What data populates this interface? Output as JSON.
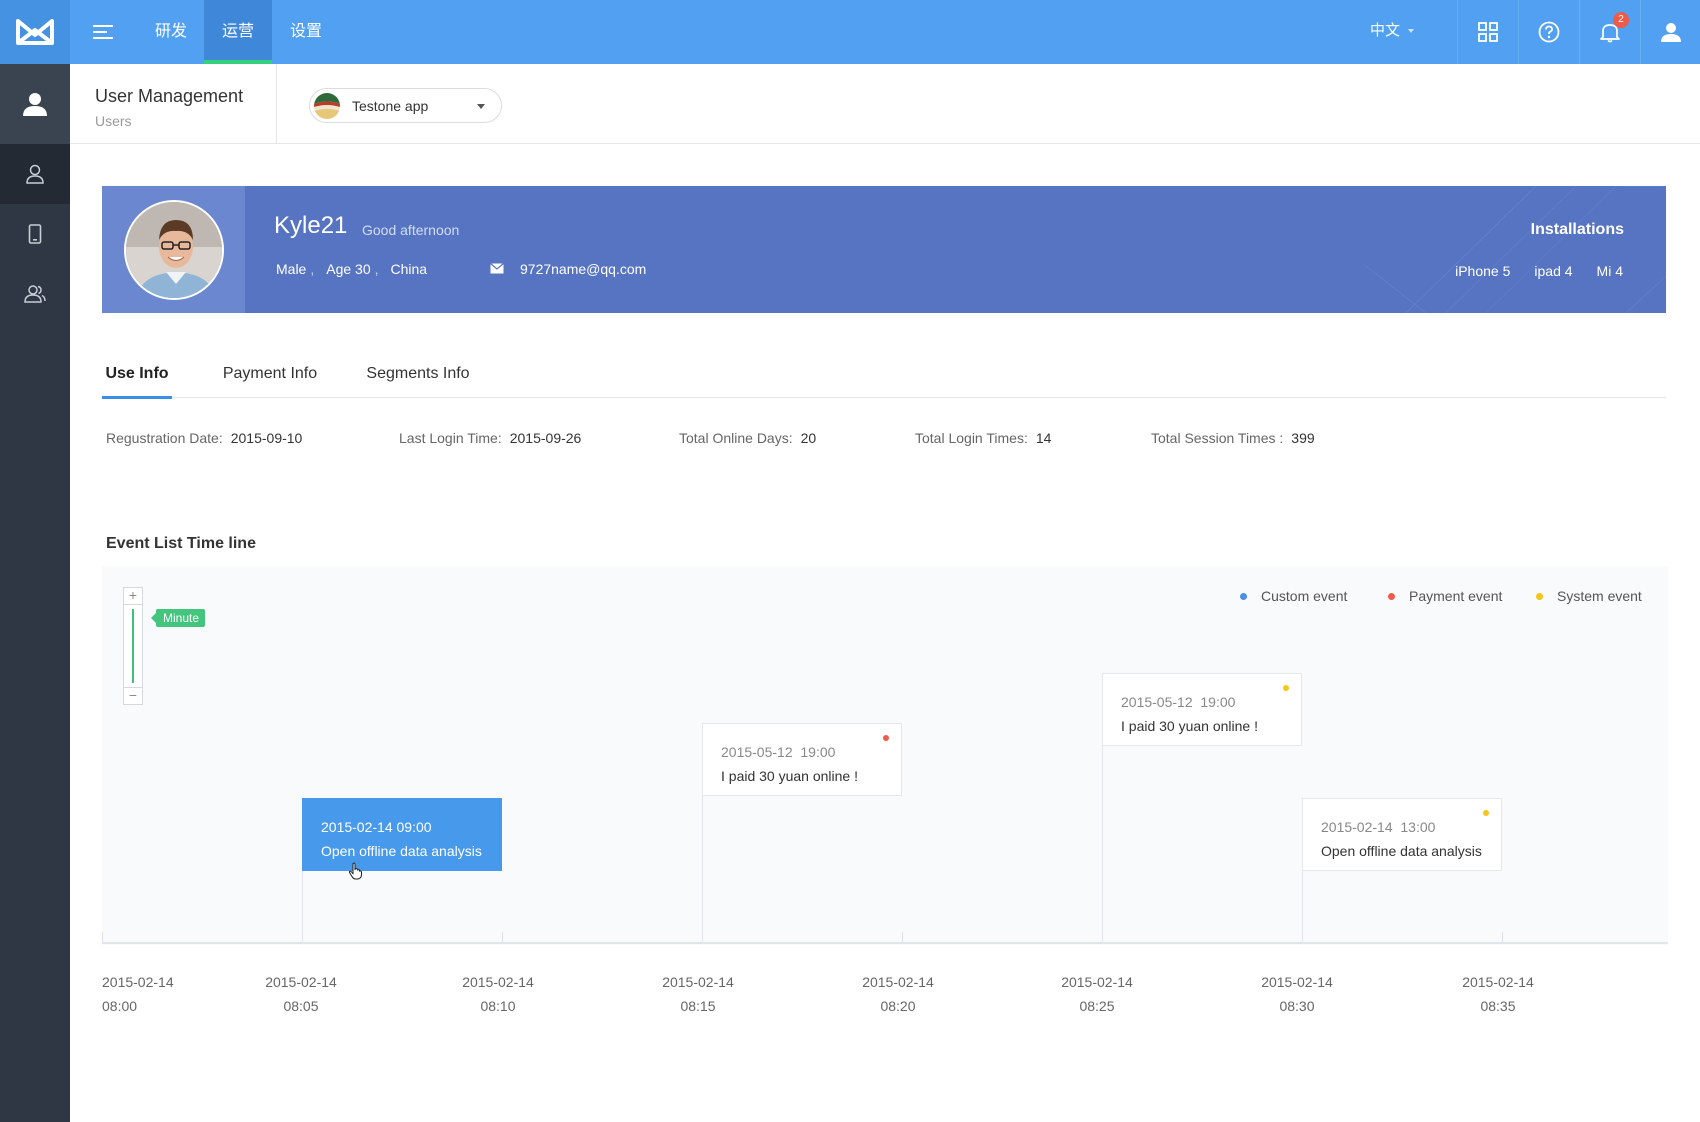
{
  "topbar": {
    "nav": [
      "研发",
      "运营",
      "设置"
    ],
    "active_nav": "运营",
    "language": "中文",
    "notification_count": "2"
  },
  "sidebar": {
    "items": [
      "user-profile",
      "users",
      "devices",
      "groups"
    ]
  },
  "subheader": {
    "title": "User Management",
    "breadcrumb": "Users",
    "app_name": "Testone app"
  },
  "profile": {
    "name": "Kyle21",
    "greeting": "Good afternoon",
    "gender": "Male",
    "age": "Age 30",
    "country": "China",
    "email": "9727name@qq.com",
    "installations_title": "Installations",
    "installations": [
      "iPhone 5",
      "ipad 4",
      "Mi 4"
    ]
  },
  "tabs": [
    "Use Info",
    "Payment Info",
    "Segments Info"
  ],
  "stats": [
    {
      "label": "Regustration Date:",
      "value": "2015-09-10"
    },
    {
      "label": "Last Login Time:",
      "value": "2015-09-26"
    },
    {
      "label": "Total Online Days:",
      "value": "20"
    },
    {
      "label": "Total Login Times:",
      "value": "14"
    },
    {
      "label": "Total Session Times :",
      "value": "399"
    }
  ],
  "timeline": {
    "title": "Event List Time line",
    "zoom_level": "Minute",
    "legend": [
      {
        "label": "Custom event",
        "color": "#4a90e2"
      },
      {
        "label": "Payment event",
        "color": "#ef5a4a"
      },
      {
        "label": "System event",
        "color": "#f5c518"
      }
    ],
    "events": [
      {
        "time": "2015-02-14 09:00",
        "text": "Open offline data analysis",
        "type": "custom",
        "selected": true
      },
      {
        "time": "2015-05-12  19:00",
        "text": "I paid 30 yuan online !",
        "type": "payment",
        "selected": false
      },
      {
        "time": "2015-05-12  19:00",
        "text": "I paid 30 yuan online !",
        "type": "system",
        "selected": false
      },
      {
        "time": "2015-02-14  13:00",
        "text": "Open offline data analysis",
        "type": "system",
        "selected": false
      }
    ],
    "x_labels": [
      {
        "date": "2015-02-14",
        "time": "08:00"
      },
      {
        "date": "2015-02-14",
        "time": "08:05"
      },
      {
        "date": "2015-02-14",
        "time": "08:10"
      },
      {
        "date": "2015-02-14",
        "time": "08:15"
      },
      {
        "date": "2015-02-14",
        "time": "08:20"
      },
      {
        "date": "2015-02-14",
        "time": "08:25"
      },
      {
        "date": "2015-02-14",
        "time": "08:30"
      },
      {
        "date": "2015-02-14",
        "time": "08:35"
      }
    ]
  }
}
